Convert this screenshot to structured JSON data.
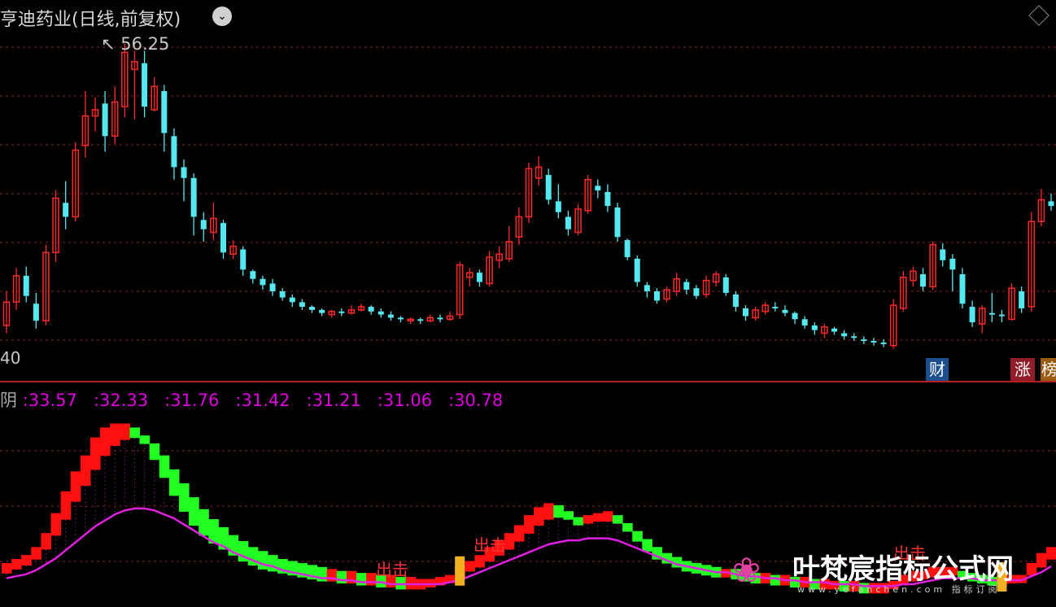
{
  "header": {
    "title": "亨迪药业(日线,前复权)",
    "dropdown_icon": "chevron-down-icon",
    "layout_icon": "diamond-icon"
  },
  "main_chart": {
    "peak_label": "56.25",
    "low_axis_label": "40",
    "badges": [
      "财",
      "涨",
      "榜"
    ]
  },
  "indicator": {
    "lead": "阴",
    "values": [
      ":33.57",
      ":32.33",
      ":31.76",
      ":31.42",
      ":31.21",
      ":31.06",
      ":30.78"
    ],
    "signal_labels": [
      "出击",
      "出击",
      "出击"
    ]
  },
  "watermark": {
    "text": "叶梵宸指标公式网",
    "url": "www.yefanchen.com 指标订阅"
  },
  "colors": {
    "up": "#ff2a2a",
    "down": "#54e8f0",
    "grid": "#8a1a1a",
    "ribbon_up": "#ff1010",
    "ribbon_down": "#22ff22",
    "avg_line": "#e020e0"
  },
  "chart_data": {
    "type": "candlestick",
    "candles": [
      [
        38.1,
        39.6,
        40.3,
        37.6
      ],
      [
        39.6,
        41.3,
        41.8,
        39.1
      ],
      [
        41.3,
        40.0,
        41.9,
        39.6
      ],
      [
        39.5,
        38.4,
        40.2,
        37.9
      ],
      [
        38.4,
        42.8,
        43.3,
        38.1
      ],
      [
        42.8,
        46.3,
        46.8,
        42.2
      ],
      [
        46.0,
        45.1,
        47.4,
        44.3
      ],
      [
        45.1,
        49.4,
        49.9,
        44.8
      ],
      [
        49.7,
        51.6,
        53.2,
        48.9
      ],
      [
        51.6,
        52.0,
        52.8,
        50.6
      ],
      [
        52.4,
        50.3,
        53.2,
        49.3
      ],
      [
        50.3,
        52.5,
        53.5,
        49.8
      ],
      [
        52.2,
        55.7,
        56.25,
        51.5
      ],
      [
        54.6,
        55.1,
        55.8,
        51.4
      ],
      [
        55.0,
        52.2,
        55.8,
        51.5
      ],
      [
        52.0,
        53.5,
        54.1,
        51.9
      ],
      [
        53.2,
        50.5,
        53.6,
        49.3
      ],
      [
        50.3,
        48.3,
        50.8,
        47.5
      ],
      [
        48.3,
        47.6,
        48.8,
        46.1
      ],
      [
        47.6,
        45.1,
        47.9,
        43.9
      ],
      [
        44.9,
        44.3,
        45.4,
        43.5
      ],
      [
        44.1,
        45.0,
        46.0,
        43.6
      ],
      [
        44.7,
        42.8,
        44.9,
        42.4
      ],
      [
        42.7,
        43.2,
        43.6,
        42.4
      ],
      [
        43.0,
        41.7,
        43.2,
        41.3
      ],
      [
        41.6,
        41.1,
        41.7,
        40.8
      ],
      [
        41.1,
        40.7,
        41.3,
        40.4
      ],
      [
        40.8,
        40.3,
        41.1,
        40.0
      ],
      [
        40.3,
        39.9,
        40.5,
        39.7
      ],
      [
        39.9,
        39.6,
        40.1,
        39.3
      ],
      [
        39.6,
        39.3,
        39.8,
        39.1
      ],
      [
        39.3,
        39.1,
        39.4,
        38.9
      ],
      [
        39.1,
        38.9,
        39.2,
        38.7
      ],
      [
        38.8,
        39.0,
        39.1,
        38.6
      ],
      [
        39.0,
        38.9,
        39.2,
        38.7
      ],
      [
        38.9,
        39.1,
        39.4,
        38.8
      ],
      [
        39.1,
        39.3,
        39.5,
        39.0
      ],
      [
        39.3,
        39.0,
        39.4,
        38.8
      ],
      [
        39.0,
        38.8,
        39.2,
        38.6
      ],
      [
        38.8,
        38.6,
        39.0,
        38.4
      ],
      [
        38.6,
        38.5,
        38.7,
        38.3
      ],
      [
        38.4,
        38.5,
        38.6,
        38.2
      ],
      [
        38.5,
        38.4,
        38.6,
        38.2
      ],
      [
        38.4,
        38.6,
        38.8,
        38.3
      ],
      [
        38.6,
        38.5,
        38.8,
        38.3
      ],
      [
        38.5,
        38.7,
        39.0,
        38.4
      ],
      [
        38.8,
        42.0,
        42.2,
        38.5
      ],
      [
        41.2,
        41.5,
        41.8,
        40.6
      ],
      [
        41.5,
        40.9,
        41.7,
        40.6
      ],
      [
        40.8,
        42.5,
        42.9,
        40.6
      ],
      [
        42.3,
        42.7,
        43.2,
        41.8
      ],
      [
        42.4,
        43.5,
        44.5,
        42.2
      ],
      [
        43.8,
        45.1,
        45.7,
        43.3
      ],
      [
        45.1,
        48.2,
        48.6,
        44.7
      ],
      [
        47.6,
        48.3,
        49.0,
        47.1
      ],
      [
        47.8,
        46.2,
        48.2,
        45.9
      ],
      [
        46.1,
        45.4,
        47.2,
        45.0
      ],
      [
        45.1,
        44.3,
        45.5,
        43.9
      ],
      [
        44.1,
        45.6,
        45.9,
        43.9
      ],
      [
        45.5,
        47.5,
        47.8,
        45.3
      ],
      [
        47.1,
        46.8,
        47.5,
        46.3
      ],
      [
        46.7,
        45.8,
        47.2,
        45.4
      ],
      [
        45.7,
        43.8,
        46.0,
        43.5
      ],
      [
        43.6,
        42.5,
        43.7,
        42.3
      ],
      [
        42.4,
        40.9,
        42.6,
        40.6
      ],
      [
        40.7,
        40.3,
        40.9,
        39.9
      ],
      [
        40.3,
        39.7,
        40.5,
        39.5
      ],
      [
        39.8,
        40.4,
        40.6,
        39.6
      ],
      [
        40.3,
        41.1,
        41.5,
        40.0
      ],
      [
        40.9,
        40.4,
        41.1,
        40.1
      ],
      [
        40.5,
        40.0,
        40.7,
        39.8
      ],
      [
        40.1,
        41.0,
        41.3,
        39.9
      ],
      [
        40.9,
        41.4,
        41.6,
        40.6
      ],
      [
        41.2,
        40.2,
        41.4,
        40.0
      ],
      [
        40.1,
        39.3,
        40.3,
        39.0
      ],
      [
        39.2,
        38.7,
        39.4,
        38.4
      ],
      [
        38.6,
        39.1,
        39.3,
        38.4
      ],
      [
        39.0,
        39.4,
        39.6,
        38.8
      ],
      [
        39.3,
        39.2,
        39.6,
        39.0
      ],
      [
        39.1,
        38.9,
        39.4,
        38.7
      ],
      [
        38.9,
        38.5,
        39.0,
        38.2
      ],
      [
        38.5,
        38.1,
        38.7,
        37.9
      ],
      [
        38.1,
        37.8,
        38.3,
        37.5
      ],
      [
        37.6,
        38.0,
        38.2,
        37.3
      ],
      [
        37.9,
        37.7,
        38.0,
        37.5
      ],
      [
        37.6,
        37.4,
        37.8,
        37.2
      ],
      [
        37.4,
        37.3,
        37.6,
        37.1
      ],
      [
        37.2,
        37.1,
        37.4,
        36.9
      ],
      [
        37.1,
        37.0,
        37.3,
        36.8
      ],
      [
        37.0,
        36.9,
        37.2,
        36.7
      ],
      [
        36.8,
        39.4,
        39.8,
        36.6
      ],
      [
        39.2,
        41.2,
        41.6,
        39.0
      ],
      [
        41.0,
        41.6,
        41.9,
        40.6
      ],
      [
        41.4,
        40.6,
        41.8,
        40.3
      ],
      [
        40.6,
        43.3,
        43.5,
        40.4
      ],
      [
        43.0,
        42.3,
        43.4,
        41.9
      ],
      [
        42.4,
        41.7,
        42.7,
        40.3
      ],
      [
        41.4,
        39.5,
        41.8,
        39.2
      ],
      [
        39.3,
        38.3,
        39.7,
        38.0
      ],
      [
        38.2,
        39.2,
        39.4,
        37.6
      ],
      [
        38.9,
        38.8,
        40.2,
        38.3
      ],
      [
        38.8,
        38.7,
        39.1,
        38.3
      ],
      [
        38.5,
        40.5,
        40.8,
        38.4
      ],
      [
        40.3,
        39.2,
        40.6,
        38.9
      ],
      [
        39.3,
        44.8,
        45.4,
        39.0
      ],
      [
        44.8,
        46.2,
        46.9,
        44.5
      ],
      [
        46.1,
        45.8,
        46.6,
        45.5
      ]
    ],
    "indicator_series": [
      {
        "name": "ribbon_fast",
        "values": [
          33.0,
          33.2,
          33.4,
          33.8,
          34.5,
          35.5,
          36.6,
          37.6,
          38.4,
          39.3,
          39.8,
          40.0,
          40.0,
          39.8,
          39.3,
          38.5,
          37.6,
          36.7,
          35.9,
          35.2,
          34.7,
          34.3,
          34.0,
          33.7,
          33.4,
          33.2,
          33.0,
          32.9,
          32.8,
          32.7,
          32.6,
          32.5,
          32.4,
          32.4,
          32.3,
          32.3,
          32.2,
          32.2,
          32.1,
          32.1,
          32.0,
          32.0,
          32.0,
          32.1,
          32.2,
          32.4,
          32.8,
          33.1,
          33.4,
          33.8,
          34.1,
          34.5,
          34.9,
          35.4,
          35.8,
          36.0,
          35.9,
          35.6,
          35.3,
          35.4,
          35.5,
          35.6,
          35.4,
          34.9,
          34.4,
          33.9,
          33.5,
          33.3,
          33.1,
          32.9,
          32.8,
          32.7,
          32.6,
          32.6,
          32.5,
          32.4,
          32.3,
          32.3,
          32.2,
          32.2,
          32.1,
          32.1,
          32.0,
          32.0,
          32.0,
          31.9,
          31.9,
          31.8,
          31.8,
          31.8,
          32.1,
          32.4,
          32.6,
          32.6,
          32.8,
          32.8,
          32.8,
          32.6,
          32.4,
          32.3,
          32.2,
          32.2,
          32.4,
          32.4,
          33.0,
          33.5,
          33.8
        ]
      },
      {
        "name": "ribbon_slow",
        "values": [
          32.8,
          33.0,
          33.2,
          33.5,
          34.0,
          34.7,
          35.5,
          36.4,
          37.2,
          38.0,
          38.7,
          39.2,
          39.5,
          39.6,
          39.4,
          39.0,
          38.4,
          37.7,
          37.0,
          36.3,
          35.7,
          35.2,
          34.8,
          34.4,
          34.1,
          33.8,
          33.6,
          33.4,
          33.2,
          33.1,
          33.0,
          32.9,
          32.8,
          32.7,
          32.6,
          32.6,
          32.5,
          32.5,
          32.4,
          32.4,
          32.3,
          32.3,
          32.2,
          32.2,
          32.3,
          32.4,
          32.6,
          32.9,
          33.1,
          33.4,
          33.7,
          34.0,
          34.4,
          34.8,
          35.2,
          35.5,
          35.6,
          35.5,
          35.3,
          35.3,
          35.4,
          35.4,
          35.3,
          35.0,
          34.6,
          34.2,
          33.8,
          33.5,
          33.3,
          33.1,
          33.0,
          32.9,
          32.8,
          32.7,
          32.7,
          32.6,
          32.5,
          32.5,
          32.4,
          32.4,
          32.3,
          32.3,
          32.2,
          32.2,
          32.1,
          32.1,
          32.1,
          32.0,
          32.0,
          32.0,
          32.1,
          32.2,
          32.4,
          32.5,
          32.6,
          32.7,
          32.7,
          32.6,
          32.5,
          32.4,
          32.3,
          32.3,
          32.3,
          32.4,
          32.7,
          33.1,
          33.5
        ]
      },
      {
        "name": "avg",
        "values": [
          32.4,
          32.5,
          32.6,
          32.8,
          33.1,
          33.4,
          33.8,
          34.2,
          34.6,
          35.0,
          35.3,
          35.6,
          35.8,
          35.9,
          35.9,
          35.8,
          35.6,
          35.4,
          35.1,
          34.8,
          34.5,
          34.2,
          34.0,
          33.7,
          33.5,
          33.3,
          33.1,
          33.0,
          32.8,
          32.7,
          32.6,
          32.5,
          32.4,
          32.4,
          32.3,
          32.3,
          32.2,
          32.2,
          32.2,
          32.1,
          32.1,
          32.1,
          32.1,
          32.1,
          32.1,
          32.2,
          32.3,
          32.5,
          32.7,
          32.9,
          33.1,
          33.3,
          33.5,
          33.7,
          33.9,
          34.1,
          34.2,
          34.3,
          34.3,
          34.4,
          34.4,
          34.4,
          34.3,
          34.1,
          33.9,
          33.7,
          33.5,
          33.3,
          33.1,
          33.0,
          32.9,
          32.8,
          32.7,
          32.7,
          32.6,
          32.5,
          32.5,
          32.4,
          32.4,
          32.3,
          32.3,
          32.2,
          32.2,
          32.2,
          32.1,
          32.1,
          32.1,
          32.0,
          32.0,
          32.0,
          32.0,
          32.1,
          32.1,
          32.2,
          32.3,
          32.4,
          32.4,
          32.4,
          32.4,
          32.3,
          32.3,
          32.3,
          32.3,
          32.3,
          32.5,
          32.7,
          33.0
        ]
      }
    ],
    "ylim_main": [
      36.0,
      57.5
    ],
    "ylim_indicator": [
      31.2,
      41.0
    ],
    "grid": true
  }
}
